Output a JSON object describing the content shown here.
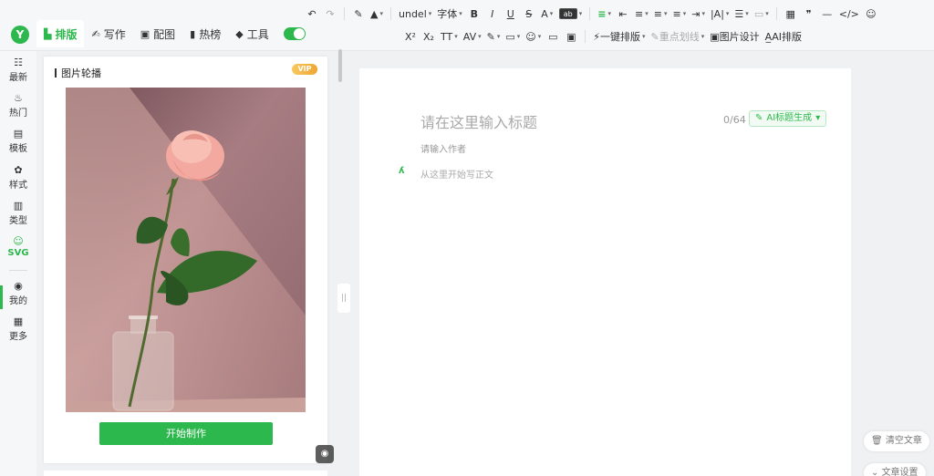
{
  "brand": {
    "logo": "Y",
    "accent": "#2db84d"
  },
  "tabs": [
    {
      "label": "排版",
      "icon": "layout-icon"
    },
    {
      "label": "写作",
      "icon": "pen-icon"
    },
    {
      "label": "配图",
      "icon": "image-icon"
    },
    {
      "label": "热榜",
      "icon": "bookmark-icon"
    },
    {
      "label": "工具",
      "icon": "toolbox-icon"
    }
  ],
  "toolbar1": [
    "↶",
    "↷",
    "✎",
    "▲",
    "undel",
    "字体",
    "B",
    "I",
    "U",
    "S",
    "A",
    "ab",
    "≡",
    "⇤",
    "≡",
    "≡",
    "≡",
    "⇥",
    "|A|",
    "☰",
    "▭",
    "▦",
    "❞",
    "—",
    "</>",
    "☺"
  ],
  "toolbar2": {
    "format": [
      "X²",
      "X₂",
      "TT",
      "AV",
      "✎",
      "▭",
      "☺",
      "▭",
      "▣"
    ],
    "one_click": "一键排版",
    "highlight": "重点划线",
    "image_design": "图片设计",
    "ai_layout": "AI排版"
  },
  "rail": [
    {
      "label": "最新",
      "icon": "☷"
    },
    {
      "label": "热门",
      "icon": "♨"
    },
    {
      "label": "模板",
      "icon": "▤"
    },
    {
      "label": "样式",
      "icon": "✿"
    },
    {
      "label": "类型",
      "icon": "▥"
    },
    {
      "label": "SVG",
      "icon": "☺"
    },
    {
      "label": "我的",
      "icon": "◉"
    },
    {
      "label": "更多",
      "icon": "▦"
    }
  ],
  "panel": {
    "title": "图片轮播",
    "badge": "VIP",
    "button": "开始制作"
  },
  "editor": {
    "title_placeholder": "请在这里输入标题",
    "count": "0/64",
    "ai_title": "AI标题生成",
    "author_placeholder": "请输入作者",
    "body_placeholder": "从这里开始写正文"
  },
  "actions": {
    "clear": "清空文章",
    "settings": "文章设置"
  }
}
